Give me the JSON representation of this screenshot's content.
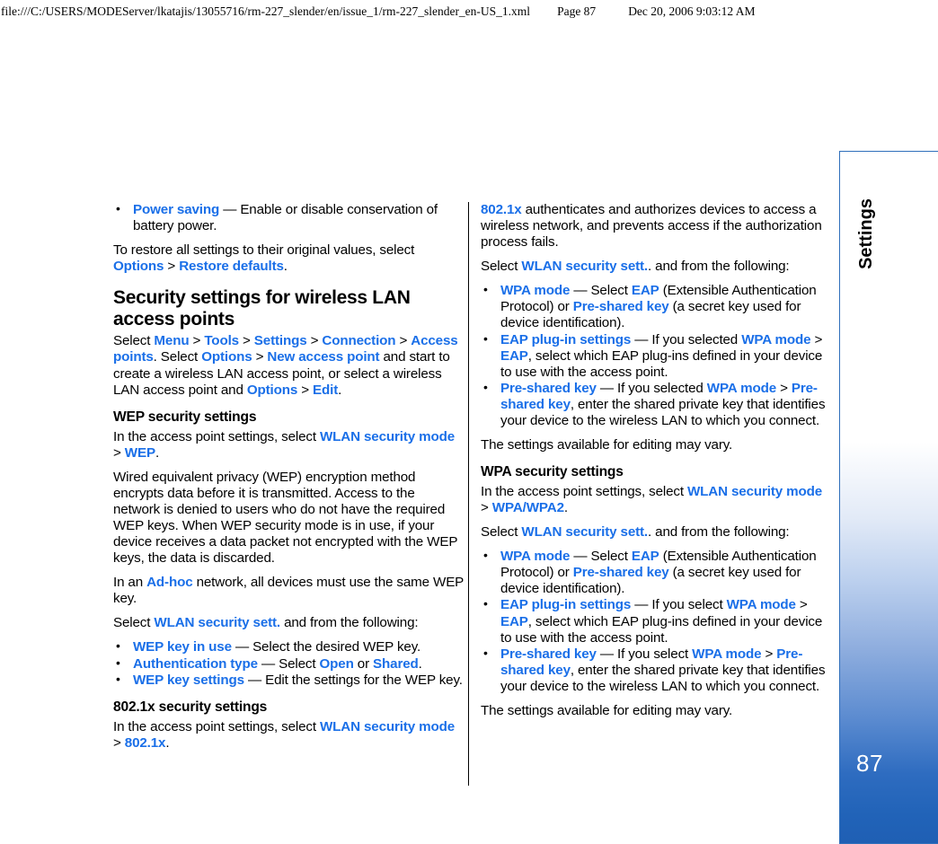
{
  "print_header": {
    "file_path": "file:///C:/USERS/MODEServer/lkatajis/13055716/rm-227_slender/en/issue_1/rm-227_slender_en-US_1.xml",
    "page_label": "Page 87",
    "timestamp": "Dec 20, 2006 9:03:12 AM"
  },
  "thumb_tab": {
    "chapter_label": "Settings",
    "page_number": "87",
    "accent_color": "#1f5fb4",
    "border_color": "#2f6fbb"
  },
  "colors": {
    "link_blue": "#1a6fe8",
    "body_text": "#000000"
  },
  "left_column": {
    "bullets_intro": [
      {
        "link": "Power saving",
        "dash": " — ",
        "text": "Enable or disable conservation of battery power."
      }
    ],
    "restore_para": {
      "lead": "To restore all settings to their original values, select ",
      "link1": "Options",
      "sep": " > ",
      "link2": "Restore defaults",
      "tail": "."
    },
    "section_title": "Security settings for wireless LAN access points",
    "select_menu_para": {
      "lead": "Select ",
      "l1": "Menu",
      "l2": "Tools",
      "l3": "Settings",
      "l4": "Connection",
      "l5": "Access points",
      "mid1": ". Select ",
      "l6": "Options",
      "l7": "New access point",
      "mid2": " and start to create a wireless LAN access point, or select a wireless LAN access point and ",
      "l8": "Options",
      "l9": "Edit",
      "tail": ".",
      "sep": " > "
    },
    "wep_heading": "WEP security settings",
    "wep_select_para": {
      "lead": "In the access point settings, select ",
      "l1": "WLAN security mode",
      "sep": " > ",
      "l2": "WEP",
      "tail": "."
    },
    "wep_body_para": "Wired equivalent privacy (WEP) encryption method encrypts data before it is transmitted. Access to the network is denied to users who do not have the required WEP keys. When WEP security mode is in use, if your device receives a data packet not encrypted with the WEP keys, the data is discarded.",
    "adhoc_para": {
      "lead": "In an ",
      "l1": "Ad-hoc",
      "tail": " network, all devices must use the same WEP key."
    },
    "wep_select_sett_para": {
      "lead": "Select ",
      "l1": "WLAN security sett.",
      "tail": " and from the following:"
    },
    "wep_bullets": [
      {
        "link": "WEP key in use",
        "dash": " — ",
        "text": "Select the desired WEP key."
      },
      {
        "link": "Authentication type",
        "dash": " — ",
        "text_pre": "Select ",
        "link_a": "Open",
        "text_mid": " or ",
        "link_b": "Shared",
        "text_post": "."
      },
      {
        "link": "WEP key settings",
        "dash": " — ",
        "text": "Edit the settings for the WEP key."
      }
    ],
    "eight021x_heading": "802.1x security settings",
    "eight021x_select_para": {
      "lead": "In the access point settings, select ",
      "l1": "WLAN security mode",
      "sep": " > ",
      "l2": "802.1x",
      "tail": "."
    }
  },
  "right_column": {
    "intro_para": {
      "l1": "802.1x",
      "text": " authenticates and authorizes devices to access a wireless network, and prevents access if the authorization process fails."
    },
    "select_sett_para_1": {
      "lead": "Select ",
      "l1": "WLAN security sett.",
      "tail": ". and from the following:"
    },
    "x_bullets": [
      {
        "link": "WPA mode",
        "dash": " — ",
        "t1": "Select ",
        "la": "EAP",
        "t2": " (Extensible Authentication Protocol) or ",
        "lb": "Pre-shared key",
        "t3": " (a secret key used for device identification)."
      },
      {
        "link": "EAP plug-in settings",
        "dash": " — ",
        "t1": "If you selected ",
        "la": "WPA mode",
        "sep": " > ",
        "lb": "EAP",
        "t2": ", select which EAP plug-ins defined in your device to use with the access point."
      },
      {
        "link": "Pre-shared key",
        "dash": " — ",
        "t1": "If you selected ",
        "la": "WPA mode",
        "sep": " > ",
        "lb": "Pre-shared key",
        "t2": ", enter the shared private key that identifies your device to the wireless LAN to which you connect."
      }
    ],
    "vary_para_1": "The settings available for editing may vary.",
    "wpa_heading": "WPA security settings",
    "wpa_select_para": {
      "lead": "In the access point settings, select ",
      "l1": "WLAN security mode",
      "sep": " > ",
      "l2": "WPA/WPA2",
      "tail": "."
    },
    "select_sett_para_2": {
      "lead": "Select ",
      "l1": "WLAN security sett.",
      "tail": ". and from the following:"
    },
    "wpa_bullets": [
      {
        "link": "WPA mode",
        "dash": " — ",
        "t1": "Select ",
        "la": "EAP",
        "t2": " (Extensible Authentication Protocol) or ",
        "lb": "Pre-shared key",
        "t3": " (a secret key used for device identification)."
      },
      {
        "link": "EAP plug-in settings",
        "dash": " — ",
        "t1": "If you select ",
        "la": "WPA mode",
        "sep": " > ",
        "lb": "EAP",
        "t2": ", select which EAP plug-ins defined in your device to use with the access point."
      },
      {
        "link": "Pre-shared key",
        "dash": " — ",
        "t1": "If you select ",
        "la": "WPA mode",
        "sep": " > ",
        "lb": "Pre-shared key",
        "t2": ", enter the shared private key that identifies your device to the wireless LAN to which you connect."
      }
    ],
    "vary_para_2": "The settings available for editing may vary."
  }
}
